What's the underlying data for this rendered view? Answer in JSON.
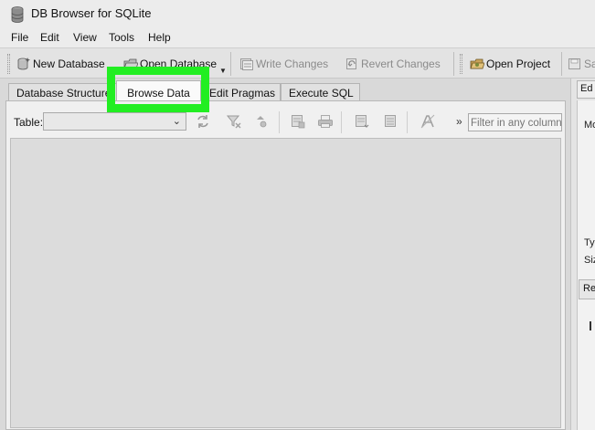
{
  "window": {
    "title": "DB Browser for SQLite",
    "icon": "database-icon"
  },
  "menu": [
    {
      "label": "File"
    },
    {
      "label": "Edit"
    },
    {
      "label": "View"
    },
    {
      "label": "Tools"
    },
    {
      "label": "Help"
    }
  ],
  "toolbar": {
    "new_database": "New Database",
    "open_database": "Open Database",
    "write_changes": "Write Changes",
    "revert_changes": "Revert Changes",
    "open_project": "Open Project",
    "save_project_partial": "Sa"
  },
  "tabs": [
    {
      "label": "Database Structure",
      "active": false
    },
    {
      "label": "Browse Data",
      "active": true
    },
    {
      "label": "Edit Pragmas",
      "active": false
    },
    {
      "label": "Execute SQL",
      "active": false
    }
  ],
  "browse": {
    "table_label": "Table:",
    "table_value": "",
    "more_label": "»",
    "filter_placeholder": "Filter in any column"
  },
  "right_dock": {
    "tab_partial": "Ed",
    "label_mode_partial": "Mo",
    "label_type_partial": "Ty",
    "label_size_partial": "Siz",
    "button_partial": "Re"
  },
  "colors": {
    "highlight": "#22ee22",
    "window_bg": "#d9d9d9"
  }
}
